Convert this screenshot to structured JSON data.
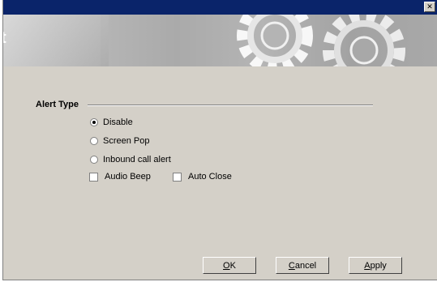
{
  "window": {
    "close_glyph": "✕"
  },
  "banner": {
    "title": "t"
  },
  "alert_type": {
    "label": "Alert Type",
    "options": [
      {
        "label": "Disable",
        "checked": true
      },
      {
        "label": "Screen Pop",
        "checked": false
      },
      {
        "label": "Inbound call alert",
        "checked": false
      }
    ],
    "checkboxes": [
      {
        "label": "Audio Beep",
        "checked": false
      },
      {
        "label": "Auto Close",
        "checked": false
      }
    ]
  },
  "buttons": {
    "ok": {
      "accel": "O",
      "rest": "K"
    },
    "cancel": {
      "accel": "C",
      "rest": "ancel"
    },
    "apply": {
      "accel": "A",
      "rest": "pply"
    }
  }
}
